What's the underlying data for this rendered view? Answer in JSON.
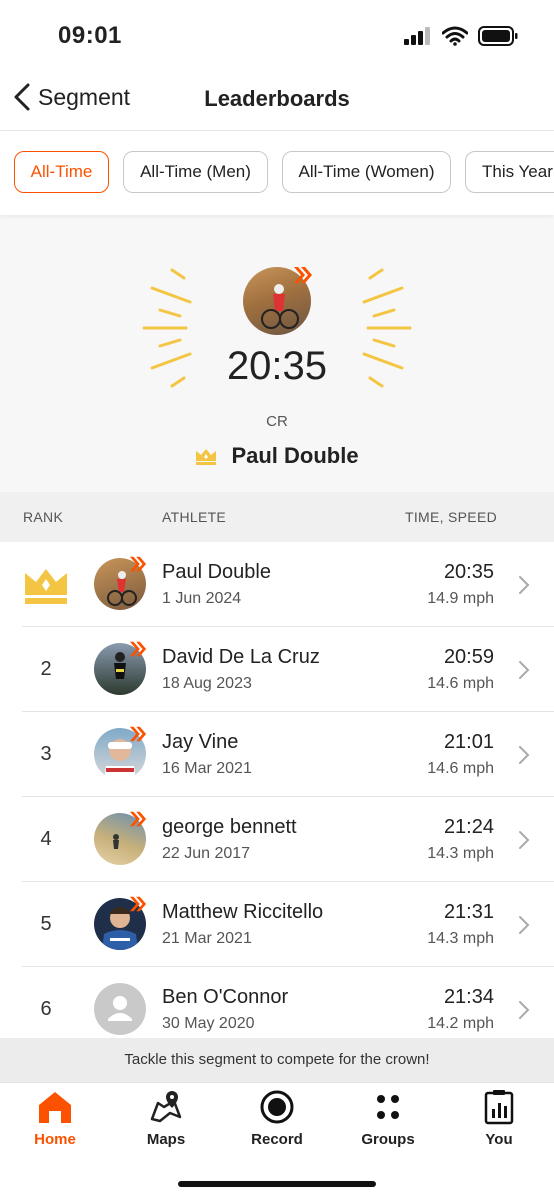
{
  "status_bar": {
    "time": "09:01"
  },
  "nav": {
    "back_label": "Segment",
    "title": "Leaderboards"
  },
  "filters": [
    {
      "label": "All-Time",
      "active": true
    },
    {
      "label": "All-Time (Men)",
      "active": false
    },
    {
      "label": "All-Time (Women)",
      "active": false
    },
    {
      "label": "This Year",
      "active": false
    }
  ],
  "hero": {
    "time": "20:35",
    "subtitle": "CR",
    "name": "Paul Double"
  },
  "table": {
    "headers": {
      "rank": "RANK",
      "athlete": "ATHLETE",
      "time_speed": "TIME, SPEED"
    },
    "rows": [
      {
        "rank": "",
        "crown": true,
        "name": "Paul Double",
        "date": "1 Jun 2024",
        "time": "20:35",
        "speed": "14.9 mph"
      },
      {
        "rank": "2",
        "name": "David De La Cruz",
        "date": "18 Aug 2023",
        "time": "20:59",
        "speed": "14.6 mph"
      },
      {
        "rank": "3",
        "name": "Jay Vine",
        "date": "16 Mar 2021",
        "time": "21:01",
        "speed": "14.6 mph"
      },
      {
        "rank": "4",
        "name": "george bennett",
        "date": "22 Jun 2017",
        "time": "21:24",
        "speed": "14.3 mph"
      },
      {
        "rank": "5",
        "name": "Matthew Riccitello",
        "date": "21 Mar 2021",
        "time": "21:31",
        "speed": "14.3 mph"
      },
      {
        "rank": "6",
        "name": "Ben O'Connor",
        "date": "30 May 2020",
        "time": "21:34",
        "speed": "14.2 mph"
      }
    ]
  },
  "banner": "Tackle this segment to compete for the crown!",
  "tabs": [
    {
      "label": "Home",
      "icon": "home-icon",
      "active": true
    },
    {
      "label": "Maps",
      "icon": "maps-icon",
      "active": false
    },
    {
      "label": "Record",
      "icon": "record-icon",
      "active": false
    },
    {
      "label": "Groups",
      "icon": "groups-icon",
      "active": false
    },
    {
      "label": "You",
      "icon": "you-icon",
      "active": false
    }
  ],
  "colors": {
    "accent": "#fc5200",
    "crown": "#f4c542"
  }
}
